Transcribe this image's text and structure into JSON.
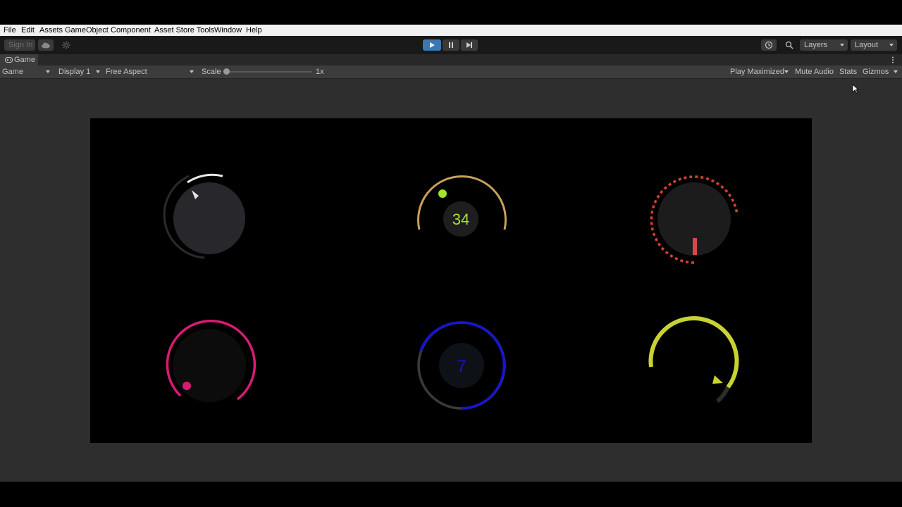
{
  "menu": [
    "File",
    "Edit",
    "Assets",
    "GameObject",
    "Component",
    "Asset Store Tools",
    "Window",
    "Help"
  ],
  "toolbar": {
    "sign_in": "Sign In",
    "layers_label": "Layers",
    "layout_label": "Layout"
  },
  "tab": {
    "label": "Game"
  },
  "gamebar": {
    "view_mode": "Game",
    "display": "Display 1",
    "aspect": "Free Aspect",
    "scale_label": "Scale",
    "scale_value": "1x",
    "play_mode": "Play Maximized",
    "mute": "Mute Audio",
    "stats": "Stats",
    "gizmos": "Gizmos"
  },
  "dials": [
    {
      "id": "white-knob",
      "accent": "#e8e8e8"
    },
    {
      "id": "gold-counter",
      "accent": "#c8a05a",
      "dot": "#a6e22e",
      "value": "34",
      "value_color": "#a6e22e"
    },
    {
      "id": "red-dashed",
      "accent": "#d0432e",
      "pointer": "#d94848"
    },
    {
      "id": "pink-knob",
      "accent": "#d81b72"
    },
    {
      "id": "blue-counter",
      "accent": "#1414d8",
      "value": "7",
      "value_color": "#1414c8"
    },
    {
      "id": "lime-arc",
      "accent": "#c8d232"
    }
  ]
}
